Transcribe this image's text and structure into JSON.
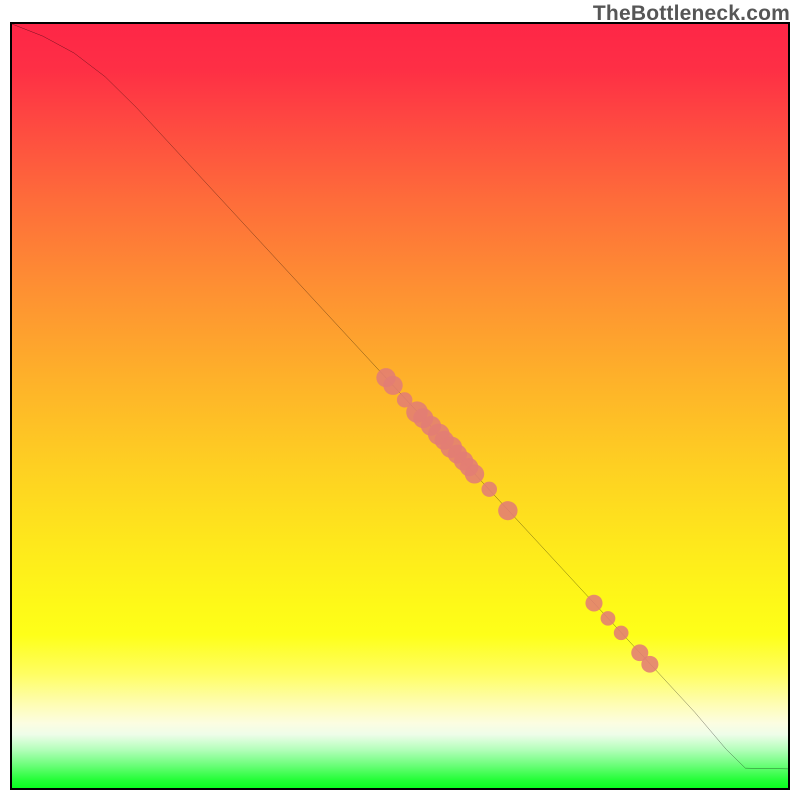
{
  "watermark": "TheBottleneck.com",
  "chart_data": {
    "type": "line",
    "title": "",
    "xlabel": "",
    "ylabel": "",
    "xlim": [
      0,
      100
    ],
    "ylim": [
      0,
      100
    ],
    "grid": false,
    "legend": false,
    "series": [
      {
        "name": "curve",
        "style": "line",
        "color": "#000000",
        "x": [
          0,
          4,
          8,
          12,
          16,
          20,
          24,
          28,
          32,
          36,
          40,
          44,
          48,
          52,
          56,
          60,
          64,
          68,
          72,
          76,
          80,
          84,
          88,
          92,
          94.5,
          100
        ],
        "y": [
          100,
          98.4,
          96.2,
          93.1,
          89.1,
          84.7,
          80.3,
          75.9,
          71.5,
          67.1,
          62.7,
          58.3,
          53.9,
          49.5,
          45.1,
          40.7,
          36.3,
          31.9,
          27.5,
          23.1,
          18.7,
          14.3,
          9.9,
          5.1,
          2.6,
          2.5
        ]
      },
      {
        "name": "points",
        "style": "scatter",
        "color": "#e37d74",
        "points": [
          {
            "x": 48.2,
            "y": 53.7,
            "r": 1.25
          },
          {
            "x": 49.1,
            "y": 52.7,
            "r": 1.25
          },
          {
            "x": 50.6,
            "y": 50.8,
            "r": 1.0
          },
          {
            "x": 52.2,
            "y": 49.2,
            "r": 1.4
          },
          {
            "x": 53.0,
            "y": 48.4,
            "r": 1.3
          },
          {
            "x": 54.0,
            "y": 47.4,
            "r": 1.3
          },
          {
            "x": 55.0,
            "y": 46.3,
            "r": 1.4
          },
          {
            "x": 55.7,
            "y": 45.5,
            "r": 1.25
          },
          {
            "x": 56.6,
            "y": 44.6,
            "r": 1.4
          },
          {
            "x": 57.4,
            "y": 43.7,
            "r": 1.25
          },
          {
            "x": 58.2,
            "y": 42.8,
            "r": 1.25
          },
          {
            "x": 58.9,
            "y": 42.0,
            "r": 1.2
          },
          {
            "x": 59.6,
            "y": 41.1,
            "r": 1.25
          },
          {
            "x": 61.5,
            "y": 39.1,
            "r": 1.0
          },
          {
            "x": 63.9,
            "y": 36.3,
            "r": 1.25
          },
          {
            "x": 75.0,
            "y": 24.2,
            "r": 1.1
          },
          {
            "x": 76.8,
            "y": 22.2,
            "r": 0.95
          },
          {
            "x": 78.5,
            "y": 20.3,
            "r": 0.95
          },
          {
            "x": 80.9,
            "y": 17.7,
            "r": 1.1
          },
          {
            "x": 82.2,
            "y": 16.2,
            "r": 1.1
          }
        ]
      }
    ]
  }
}
